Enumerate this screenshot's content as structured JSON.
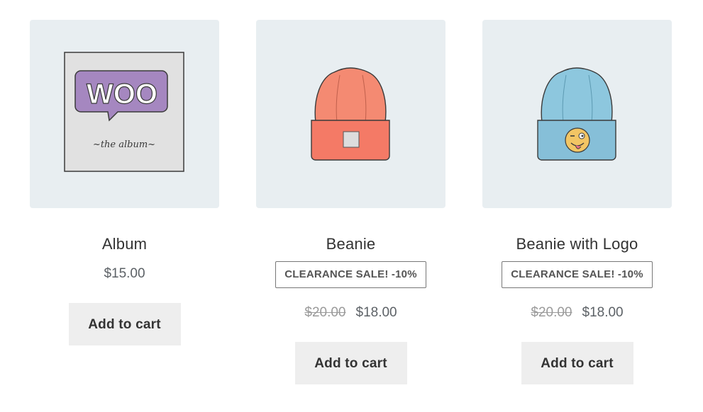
{
  "products": [
    {
      "title": "Album",
      "price": "$15.00",
      "button": "Add to cart",
      "image": "woo-album-cover",
      "cover_text": "WOO",
      "cover_subtext": "~the album~"
    },
    {
      "title": "Beanie",
      "badge": "CLEARANCE SALE! -10%",
      "old_price": "$20.00",
      "price": "$18.00",
      "button": "Add to cart",
      "image": "orange-beanie"
    },
    {
      "title": "Beanie with Logo",
      "badge": "CLEARANCE SALE! -10%",
      "old_price": "$20.00",
      "price": "$18.00",
      "button": "Add to cart",
      "image": "blue-beanie-with-emoji-logo"
    }
  ],
  "colors": {
    "thumb_bg": "#e8eef1",
    "button_bg": "#eeeeee",
    "badge_border": "#777777",
    "woo_purple": "#a587c0",
    "beanie_orange": "#f48a72",
    "beanie_blue": "#8dc7de"
  }
}
